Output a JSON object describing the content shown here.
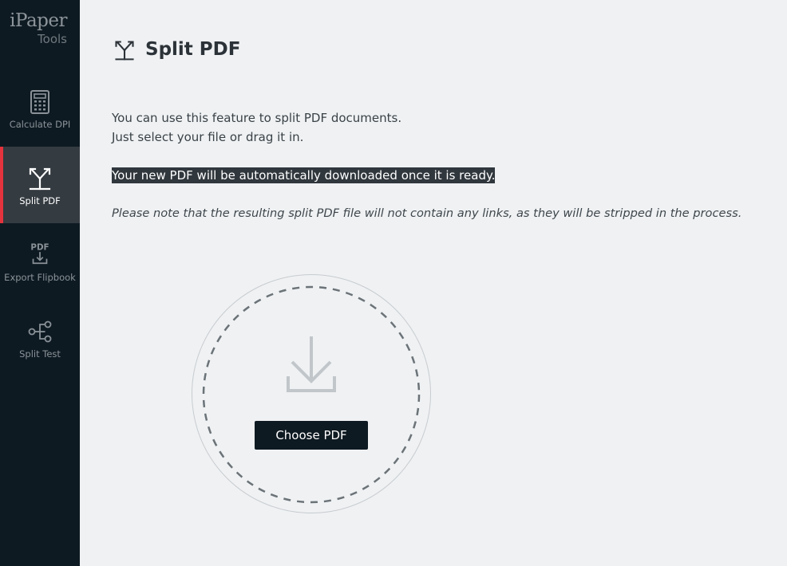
{
  "brand": {
    "name": "iPaper",
    "sub": "Tools"
  },
  "sidebar": {
    "items": [
      {
        "label": "Calculate DPI",
        "icon": "calculator-icon",
        "active": false
      },
      {
        "label": "Split PDF",
        "icon": "split-icon",
        "active": true
      },
      {
        "label": "Export Flipbook",
        "icon": "pdf-export-icon",
        "active": false
      },
      {
        "label": "Split Test",
        "icon": "split-test-icon",
        "active": false
      }
    ],
    "pdf_tag": "PDF"
  },
  "main": {
    "title": "Split PDF",
    "title_icon": "split-icon",
    "intro_line1": "You can use this feature to split PDF documents.",
    "intro_line2": "Just select your file or drag it in.",
    "highlight": "Your new PDF will be automatically downloaded once it is ready.",
    "note": "Please note that the resulting split PDF file will not contain any links, as they will be stripped in the process.",
    "dropzone": {
      "icon": "download-icon",
      "button_label": "Choose PDF"
    }
  },
  "colors": {
    "sidebar_bg": "#0e1a22",
    "active_bg": "#343b41",
    "accent": "#e4333d",
    "page_bg": "#eff1f3",
    "highlight_bg": "#30373d"
  }
}
